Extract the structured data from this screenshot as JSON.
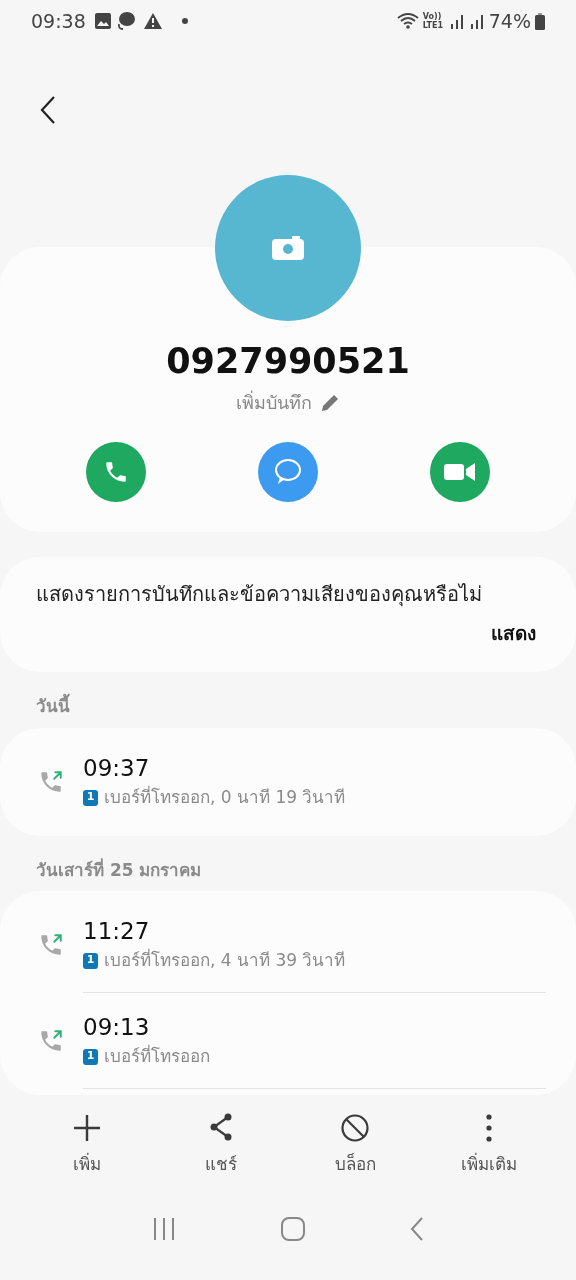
{
  "status_bar": {
    "time": "09:38",
    "network": "Vo)) LTE1",
    "battery": "74%"
  },
  "contact": {
    "number": "0927990521",
    "add_note": "เพิ่มบันทึก"
  },
  "prompt": {
    "text": "แสดงรายการบันทึกและข้อความเสียงของคุณหรือไม่",
    "action": "แสดง"
  },
  "call_groups": [
    {
      "date": "วันนี้",
      "calls": [
        {
          "kind": "outgoing",
          "time": "09:37",
          "sim": "1",
          "detail": "เบอร์ที่โทรออก, 0 นาที 19 วินาที"
        }
      ]
    },
    {
      "date": "วันเสาร์ที่ 25 มกราคม",
      "calls": [
        {
          "kind": "outgoing",
          "time": "11:27",
          "sim": "1",
          "detail": "เบอร์ที่โทรออก, 4 นาที 39 วินาที"
        },
        {
          "kind": "outgoing",
          "time": "09:13",
          "sim": "1",
          "detail": "เบอร์ที่โทรออก"
        }
      ]
    }
  ],
  "bottom_actions": [
    {
      "kind": "add",
      "label": "เพิ่ม"
    },
    {
      "kind": "share",
      "label": "แชร์"
    },
    {
      "kind": "block",
      "label": "บล็อก"
    },
    {
      "kind": "more",
      "label": "เพิ่มเติม"
    }
  ]
}
